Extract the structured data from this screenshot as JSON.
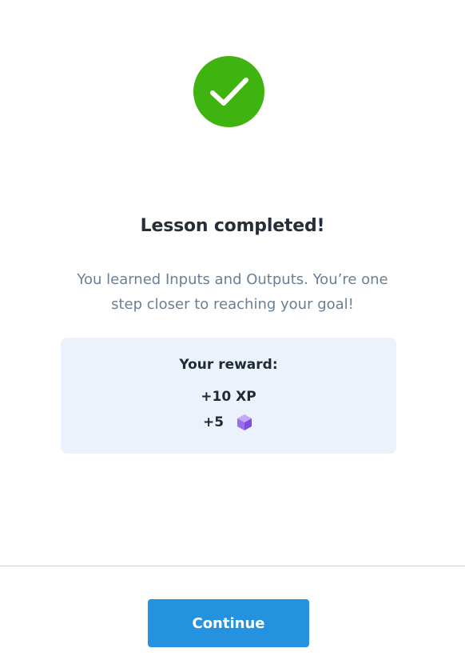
{
  "completion": {
    "icon": "checkmark-icon",
    "color": "#3fb30f",
    "title": "Lesson completed!",
    "message": "You learned Inputs and Outputs. You’re one step closer to reaching your goal!"
  },
  "reward": {
    "title": "Your reward:",
    "xp": "+10 XP",
    "gems": "+5",
    "gem_icon": "gem-cube-icon",
    "card_color": "#ebf2fc"
  },
  "footer": {
    "continue_label": "Continue",
    "button_color": "#2592e0"
  }
}
